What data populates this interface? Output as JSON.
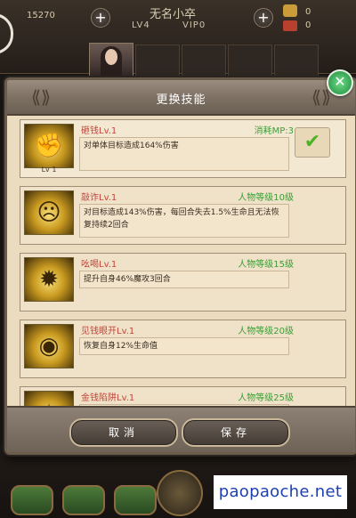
{
  "hud": {
    "coins": "15270",
    "player_name": "无名小卒",
    "level": "LV4",
    "vip": "VIP0",
    "plus_symbol": "+",
    "item_count_1": "0",
    "item_count_2": "0"
  },
  "dialog": {
    "title": "更换技能",
    "close_symbol": "✕",
    "cancel_label": "取消",
    "save_label": "保存"
  },
  "skills": [
    {
      "name": "砸钱Lv.1",
      "requirement": "消耗MP:3",
      "description": "对单体目标造成164%伤害",
      "icon_level": "Lv 1",
      "icon": "hammer-icon",
      "selected": true
    },
    {
      "name": "敲诈Lv.1",
      "requirement": "人物等级10级",
      "description": "对目标造成143%伤害，每回合失去1.5%生命且无法恢复持续2回合",
      "icon": "angry-face-icon",
      "selected": false
    },
    {
      "name": "吆喝Lv.1",
      "requirement": "人物等级15级",
      "description": "提升自身46%魔攻3回合",
      "icon": "shout-icon",
      "selected": false
    },
    {
      "name": "见钱眼开Lv.1",
      "requirement": "人物等级20级",
      "description": "恢复自身12%生命值",
      "icon": "eye-icon",
      "selected": false
    },
    {
      "name": "金钱陷阱Lv.1",
      "requirement": "人物等级25级",
      "description": "",
      "icon": "trap-icon",
      "selected": false
    }
  ],
  "watermark": "paopaoche.net",
  "colors": {
    "skill_name": "#c4463b",
    "requirement": "#3d9d37",
    "panel_bg": "#ecdcbf",
    "check": "#4cb326"
  }
}
